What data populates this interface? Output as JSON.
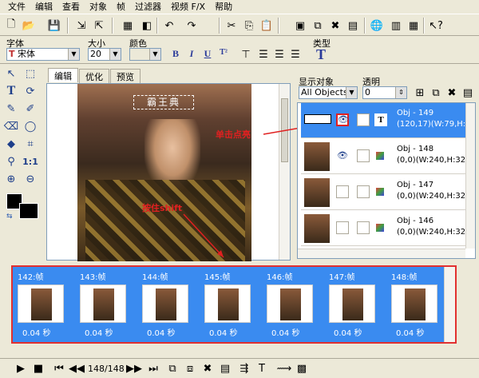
{
  "menu": [
    "文件",
    "编辑",
    "查看",
    "对象",
    "帧",
    "过滤器",
    "视频 F/X",
    "帮助"
  ],
  "font_labels": {
    "font": "字体",
    "size": "大小",
    "color": "颜色",
    "type": "类型"
  },
  "font_values": {
    "font": "宋体",
    "size": "20"
  },
  "format_buttons": [
    "B",
    "I",
    "U",
    "T²"
  ],
  "tabs": [
    "编辑",
    "优化",
    "预览"
  ],
  "canvas_caption": "霸王典",
  "annotations": {
    "click_highlight": "单击点亮",
    "hold_shift": "按住shift"
  },
  "object_panel": {
    "display_label": "显示对象",
    "transparency_label": "透明",
    "display_value": "All Objects",
    "transparency_value": "0",
    "objects": [
      {
        "name": "Obj - 149",
        "info": "(120,17)(W:79,H:"
      },
      {
        "name": "Obj - 148",
        "info": "(0,0)(W:240,H:32"
      },
      {
        "name": "Obj - 147",
        "info": "(0,0)(W:240,H:32"
      },
      {
        "name": "Obj - 146",
        "info": "(0,0)(W:240,H:32"
      }
    ]
  },
  "frames": [
    {
      "label": "142:帧",
      "time": "0.04 秒"
    },
    {
      "label": "143:帧",
      "time": "0.04 秒"
    },
    {
      "label": "144:帧",
      "time": "0.04 秒"
    },
    {
      "label": "145:帧",
      "time": "0.04 秒"
    },
    {
      "label": "146:帧",
      "time": "0.04 秒"
    },
    {
      "label": "147:帧",
      "time": "0.04 秒"
    },
    {
      "label": "148:帧",
      "time": "0.04 秒"
    }
  ],
  "playback": {
    "counter": "148/148"
  },
  "colors": {
    "accent": "#3a8bf0",
    "annotation": "#e02020"
  }
}
